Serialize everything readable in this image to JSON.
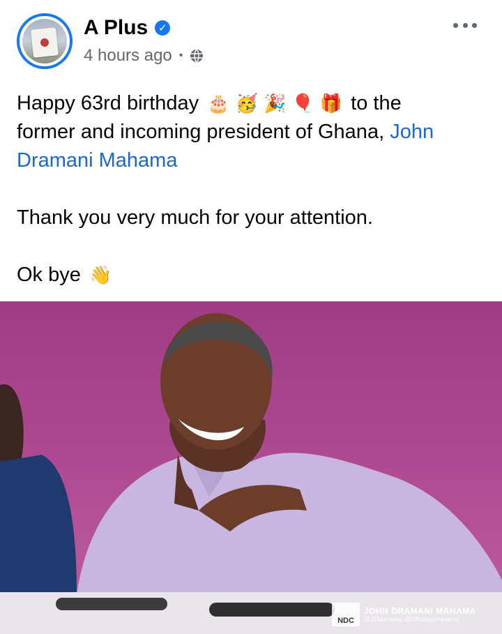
{
  "post": {
    "page_name": "A Plus",
    "timestamp": "4 hours ago",
    "separator": "•",
    "verified_mark": "✓",
    "text": {
      "line1_prefix": "Happy 63rd birthday",
      "emojis": [
        "🎂",
        "🥳",
        "🎉",
        "🎈",
        "🎁"
      ],
      "line1_suffix": "to the",
      "line2": "former and incoming president of Ghana,",
      "mention_part1": "John",
      "mention_part2": "Dramani Mahama",
      "thanks": "Thank you very much for your attention.",
      "bye": "Ok bye",
      "bye_emoji": "👋"
    }
  },
  "photo": {
    "watermark_logo": "NDC",
    "watermark_title": "JOHN DRAMANI MAHAMA",
    "watermark_handles": "@JDMahama @Officialjdmahama"
  },
  "colors": {
    "verified": "#1877f2",
    "link": "#1a66d2",
    "meta": "#65676b",
    "background_wall": "#a8418a",
    "shirt": "#c9b6e0"
  },
  "icons": [
    "verified-badge-icon",
    "globe-icon",
    "more-options-icon"
  ]
}
